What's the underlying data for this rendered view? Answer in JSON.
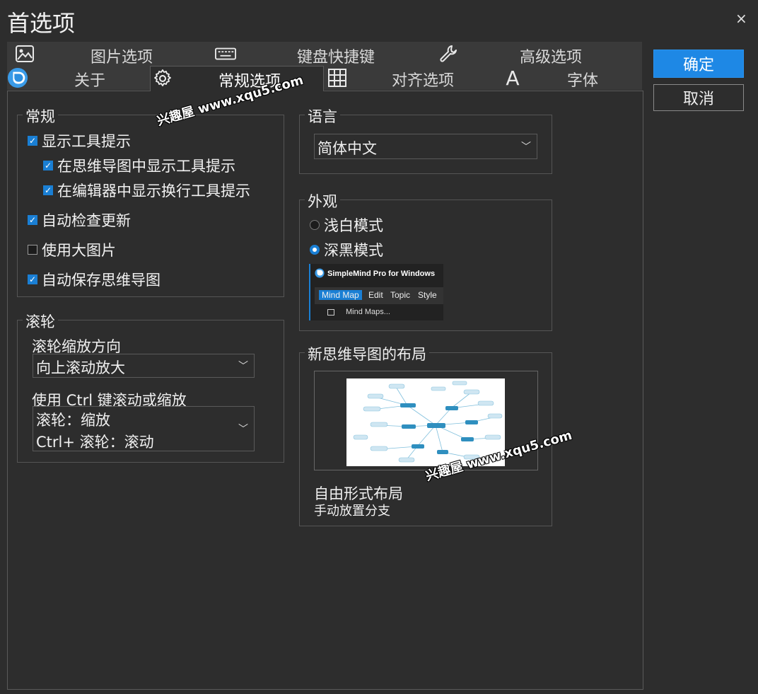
{
  "window": {
    "title": "首选项",
    "close_glyph": "×"
  },
  "tabs": [
    {
      "label": "图片选项",
      "icon": "image-icon"
    },
    {
      "label": "键盘快捷键",
      "icon": "keyboard-icon"
    },
    {
      "label": "高级选项",
      "icon": "wrench-icon"
    },
    {
      "label": "关于",
      "icon": "app-logo-icon"
    },
    {
      "label": "常规选项",
      "icon": "gear-icon",
      "active": true
    },
    {
      "label": "对齐选项",
      "icon": "grid-icon"
    },
    {
      "label": "字体",
      "icon": "font-icon",
      "icon_glyph": "A"
    }
  ],
  "buttons": {
    "ok": "确定",
    "cancel": "取消"
  },
  "general": {
    "title": "常规",
    "options": [
      {
        "label": "显示工具提示",
        "checked": true
      },
      {
        "label": "在思维导图中显示工具提示",
        "checked": true
      },
      {
        "label": "在编辑器中显示换行工具提示",
        "checked": true
      },
      {
        "label": "自动检查更新",
        "checked": true
      },
      {
        "label": "使用大图片",
        "checked": false
      },
      {
        "label": "自动保存思维导图",
        "checked": true
      }
    ]
  },
  "wheel": {
    "title": "滚轮",
    "zoom_direction_label": "滚轮缩放方向",
    "zoom_direction_value": "向上滚动放大",
    "ctrl_label": "使用 Ctrl 键滚动或缩放",
    "ctrl_value_line1": "滚轮：缩放",
    "ctrl_value_line2": "Ctrl+ 滚轮：滚动"
  },
  "language": {
    "title": "语言",
    "value": "简体中文"
  },
  "appearance": {
    "title": "外观",
    "options": [
      {
        "label": "浅白模式",
        "selected": false
      },
      {
        "label": "深黑模式",
        "selected": true
      }
    ],
    "preview": {
      "app_title": "SimpleMind Pro for Windows",
      "menu": [
        "Mind Map",
        "Edit",
        "Topic",
        "Style"
      ],
      "submenu": "Mind Maps..."
    }
  },
  "layout": {
    "title": "新思维导图的布局",
    "name": "自由形式布局",
    "description": "手动放置分支"
  },
  "watermark": "兴趣屋 www.xqu5.com",
  "colors": {
    "accent": "#1e88e5",
    "background": "#2d2d2d",
    "border": "#5a5a5a"
  }
}
